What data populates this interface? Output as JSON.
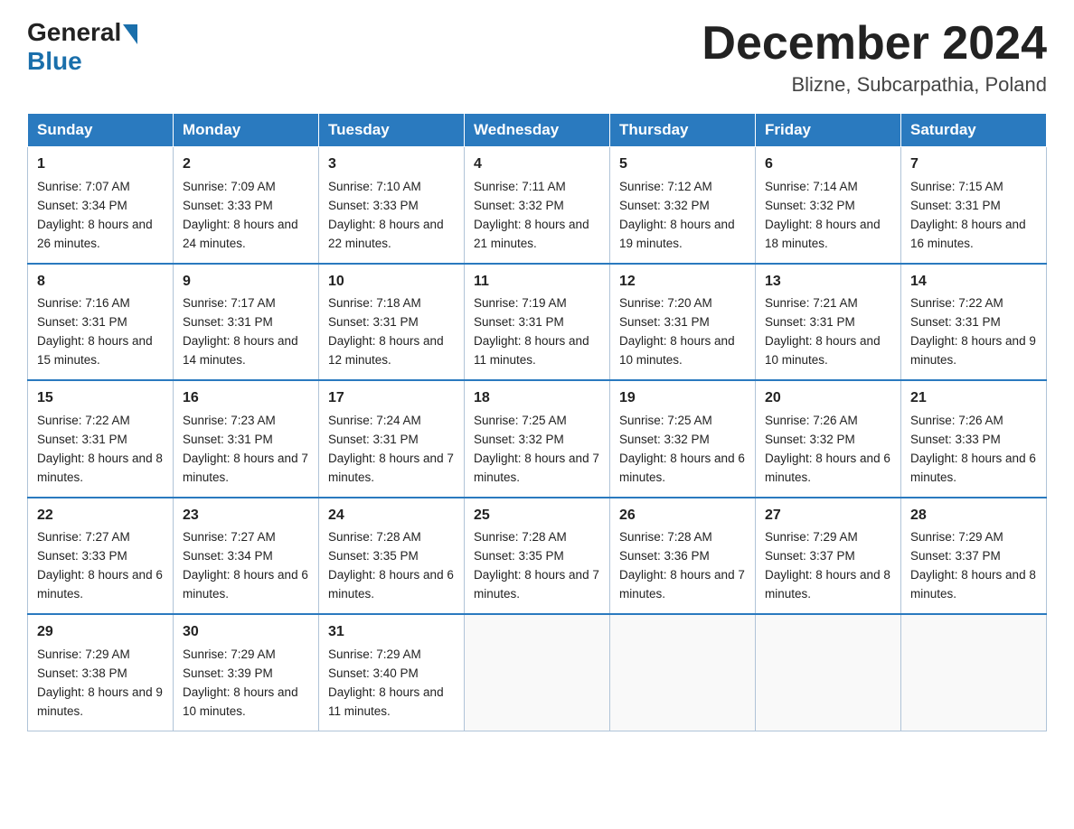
{
  "header": {
    "logo_general": "General",
    "logo_blue": "Blue",
    "title": "December 2024",
    "subtitle": "Blizne, Subcarpathia, Poland"
  },
  "columns": [
    "Sunday",
    "Monday",
    "Tuesday",
    "Wednesday",
    "Thursday",
    "Friday",
    "Saturday"
  ],
  "weeks": [
    [
      {
        "day": "1",
        "sunrise": "Sunrise: 7:07 AM",
        "sunset": "Sunset: 3:34 PM",
        "daylight": "Daylight: 8 hours and 26 minutes."
      },
      {
        "day": "2",
        "sunrise": "Sunrise: 7:09 AM",
        "sunset": "Sunset: 3:33 PM",
        "daylight": "Daylight: 8 hours and 24 minutes."
      },
      {
        "day": "3",
        "sunrise": "Sunrise: 7:10 AM",
        "sunset": "Sunset: 3:33 PM",
        "daylight": "Daylight: 8 hours and 22 minutes."
      },
      {
        "day": "4",
        "sunrise": "Sunrise: 7:11 AM",
        "sunset": "Sunset: 3:32 PM",
        "daylight": "Daylight: 8 hours and 21 minutes."
      },
      {
        "day": "5",
        "sunrise": "Sunrise: 7:12 AM",
        "sunset": "Sunset: 3:32 PM",
        "daylight": "Daylight: 8 hours and 19 minutes."
      },
      {
        "day": "6",
        "sunrise": "Sunrise: 7:14 AM",
        "sunset": "Sunset: 3:32 PM",
        "daylight": "Daylight: 8 hours and 18 minutes."
      },
      {
        "day": "7",
        "sunrise": "Sunrise: 7:15 AM",
        "sunset": "Sunset: 3:31 PM",
        "daylight": "Daylight: 8 hours and 16 minutes."
      }
    ],
    [
      {
        "day": "8",
        "sunrise": "Sunrise: 7:16 AM",
        "sunset": "Sunset: 3:31 PM",
        "daylight": "Daylight: 8 hours and 15 minutes."
      },
      {
        "day": "9",
        "sunrise": "Sunrise: 7:17 AM",
        "sunset": "Sunset: 3:31 PM",
        "daylight": "Daylight: 8 hours and 14 minutes."
      },
      {
        "day": "10",
        "sunrise": "Sunrise: 7:18 AM",
        "sunset": "Sunset: 3:31 PM",
        "daylight": "Daylight: 8 hours and 12 minutes."
      },
      {
        "day": "11",
        "sunrise": "Sunrise: 7:19 AM",
        "sunset": "Sunset: 3:31 PM",
        "daylight": "Daylight: 8 hours and 11 minutes."
      },
      {
        "day": "12",
        "sunrise": "Sunrise: 7:20 AM",
        "sunset": "Sunset: 3:31 PM",
        "daylight": "Daylight: 8 hours and 10 minutes."
      },
      {
        "day": "13",
        "sunrise": "Sunrise: 7:21 AM",
        "sunset": "Sunset: 3:31 PM",
        "daylight": "Daylight: 8 hours and 10 minutes."
      },
      {
        "day": "14",
        "sunrise": "Sunrise: 7:22 AM",
        "sunset": "Sunset: 3:31 PM",
        "daylight": "Daylight: 8 hours and 9 minutes."
      }
    ],
    [
      {
        "day": "15",
        "sunrise": "Sunrise: 7:22 AM",
        "sunset": "Sunset: 3:31 PM",
        "daylight": "Daylight: 8 hours and 8 minutes."
      },
      {
        "day": "16",
        "sunrise": "Sunrise: 7:23 AM",
        "sunset": "Sunset: 3:31 PM",
        "daylight": "Daylight: 8 hours and 7 minutes."
      },
      {
        "day": "17",
        "sunrise": "Sunrise: 7:24 AM",
        "sunset": "Sunset: 3:31 PM",
        "daylight": "Daylight: 8 hours and 7 minutes."
      },
      {
        "day": "18",
        "sunrise": "Sunrise: 7:25 AM",
        "sunset": "Sunset: 3:32 PM",
        "daylight": "Daylight: 8 hours and 7 minutes."
      },
      {
        "day": "19",
        "sunrise": "Sunrise: 7:25 AM",
        "sunset": "Sunset: 3:32 PM",
        "daylight": "Daylight: 8 hours and 6 minutes."
      },
      {
        "day": "20",
        "sunrise": "Sunrise: 7:26 AM",
        "sunset": "Sunset: 3:32 PM",
        "daylight": "Daylight: 8 hours and 6 minutes."
      },
      {
        "day": "21",
        "sunrise": "Sunrise: 7:26 AM",
        "sunset": "Sunset: 3:33 PM",
        "daylight": "Daylight: 8 hours and 6 minutes."
      }
    ],
    [
      {
        "day": "22",
        "sunrise": "Sunrise: 7:27 AM",
        "sunset": "Sunset: 3:33 PM",
        "daylight": "Daylight: 8 hours and 6 minutes."
      },
      {
        "day": "23",
        "sunrise": "Sunrise: 7:27 AM",
        "sunset": "Sunset: 3:34 PM",
        "daylight": "Daylight: 8 hours and 6 minutes."
      },
      {
        "day": "24",
        "sunrise": "Sunrise: 7:28 AM",
        "sunset": "Sunset: 3:35 PM",
        "daylight": "Daylight: 8 hours and 6 minutes."
      },
      {
        "day": "25",
        "sunrise": "Sunrise: 7:28 AM",
        "sunset": "Sunset: 3:35 PM",
        "daylight": "Daylight: 8 hours and 7 minutes."
      },
      {
        "day": "26",
        "sunrise": "Sunrise: 7:28 AM",
        "sunset": "Sunset: 3:36 PM",
        "daylight": "Daylight: 8 hours and 7 minutes."
      },
      {
        "day": "27",
        "sunrise": "Sunrise: 7:29 AM",
        "sunset": "Sunset: 3:37 PM",
        "daylight": "Daylight: 8 hours and 8 minutes."
      },
      {
        "day": "28",
        "sunrise": "Sunrise: 7:29 AM",
        "sunset": "Sunset: 3:37 PM",
        "daylight": "Daylight: 8 hours and 8 minutes."
      }
    ],
    [
      {
        "day": "29",
        "sunrise": "Sunrise: 7:29 AM",
        "sunset": "Sunset: 3:38 PM",
        "daylight": "Daylight: 8 hours and 9 minutes."
      },
      {
        "day": "30",
        "sunrise": "Sunrise: 7:29 AM",
        "sunset": "Sunset: 3:39 PM",
        "daylight": "Daylight: 8 hours and 10 minutes."
      },
      {
        "day": "31",
        "sunrise": "Sunrise: 7:29 AM",
        "sunset": "Sunset: 3:40 PM",
        "daylight": "Daylight: 8 hours and 11 minutes."
      },
      null,
      null,
      null,
      null
    ]
  ]
}
